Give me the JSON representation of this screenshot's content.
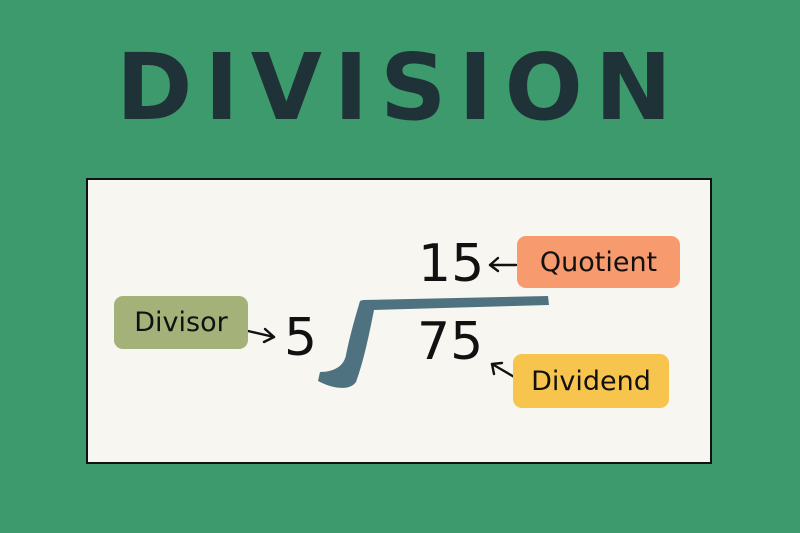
{
  "title": "DIVISION",
  "problem": {
    "quotient": "15",
    "divisor": "5",
    "dividend": "75"
  },
  "labels": {
    "quotient": "Quotient",
    "divisor": "Divisor",
    "dividend": "Dividend"
  },
  "colors": {
    "background": "#3c9a6c",
    "title": "#1f3238",
    "card": "#f8f6f1",
    "bracket": "#4e7280",
    "quotient_tag": "#f79b6e",
    "divisor_tag": "#a4b27a",
    "dividend_tag": "#f7c54d"
  }
}
